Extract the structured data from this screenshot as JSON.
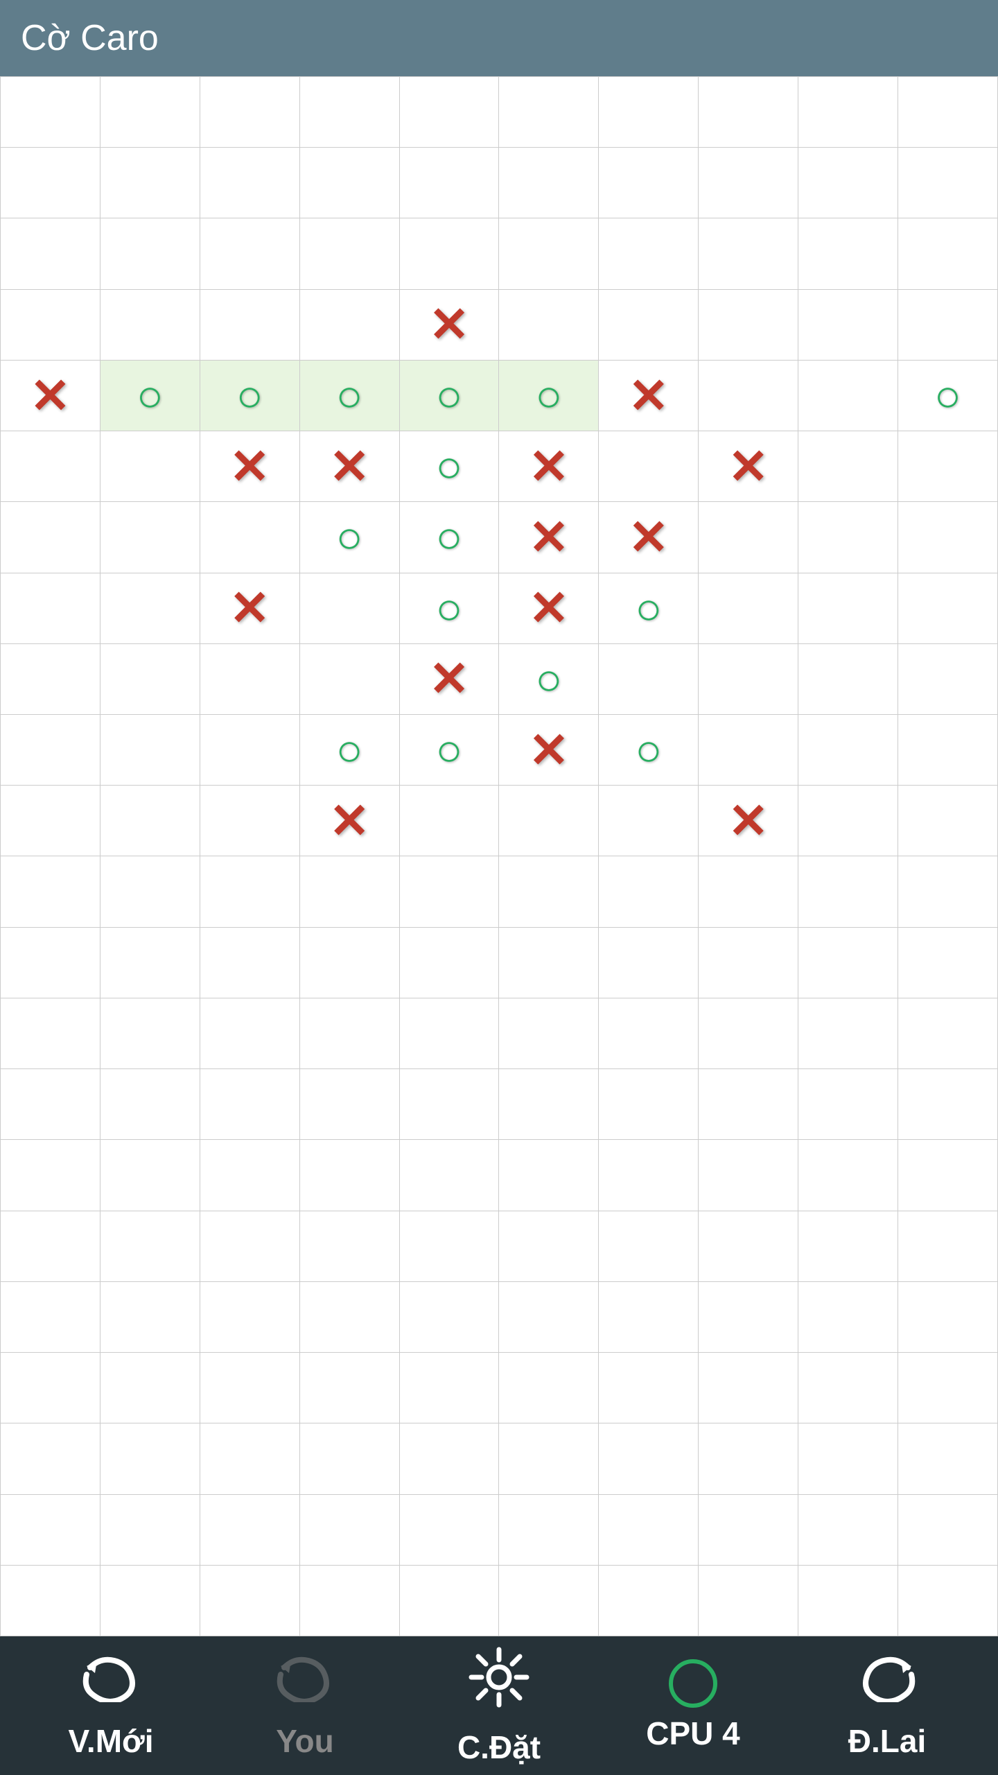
{
  "app": {
    "title": "Cờ Caro"
  },
  "board": {
    "rows": 22,
    "cols": 10,
    "cells": [
      {
        "row": 4,
        "col": 5,
        "piece": "X",
        "highlight": false
      },
      {
        "row": 5,
        "col": 1,
        "piece": "X",
        "highlight": false
      },
      {
        "row": 5,
        "col": 2,
        "piece": "O",
        "highlight": true
      },
      {
        "row": 5,
        "col": 3,
        "piece": "O",
        "highlight": true
      },
      {
        "row": 5,
        "col": 4,
        "piece": "O",
        "highlight": true
      },
      {
        "row": 5,
        "col": 5,
        "piece": "O",
        "highlight": true
      },
      {
        "row": 5,
        "col": 6,
        "piece": "O",
        "highlight": true
      },
      {
        "row": 5,
        "col": 7,
        "piece": "X",
        "highlight": false
      },
      {
        "row": 5,
        "col": 10,
        "piece": "O",
        "highlight": false
      },
      {
        "row": 6,
        "col": 3,
        "piece": "X",
        "highlight": false
      },
      {
        "row": 6,
        "col": 4,
        "piece": "X",
        "highlight": false
      },
      {
        "row": 6,
        "col": 5,
        "piece": "O",
        "highlight": false
      },
      {
        "row": 6,
        "col": 6,
        "piece": "X",
        "highlight": false
      },
      {
        "row": 6,
        "col": 8,
        "piece": "X",
        "highlight": false
      },
      {
        "row": 7,
        "col": 4,
        "piece": "O",
        "highlight": false
      },
      {
        "row": 7,
        "col": 5,
        "piece": "O",
        "highlight": false
      },
      {
        "row": 7,
        "col": 6,
        "piece": "X",
        "highlight": false
      },
      {
        "row": 7,
        "col": 7,
        "piece": "X",
        "highlight": false
      },
      {
        "row": 8,
        "col": 3,
        "piece": "X",
        "highlight": false
      },
      {
        "row": 8,
        "col": 5,
        "piece": "O",
        "highlight": false
      },
      {
        "row": 8,
        "col": 6,
        "piece": "X",
        "highlight": false
      },
      {
        "row": 8,
        "col": 7,
        "piece": "O",
        "highlight": false
      },
      {
        "row": 9,
        "col": 5,
        "piece": "X",
        "highlight": false
      },
      {
        "row": 9,
        "col": 6,
        "piece": "O",
        "highlight": false
      },
      {
        "row": 10,
        "col": 4,
        "piece": "O",
        "highlight": false
      },
      {
        "row": 10,
        "col": 5,
        "piece": "O",
        "highlight": false
      },
      {
        "row": 10,
        "col": 6,
        "piece": "X",
        "highlight": false
      },
      {
        "row": 10,
        "col": 7,
        "piece": "O",
        "highlight": false
      },
      {
        "row": 11,
        "col": 4,
        "piece": "X",
        "highlight": false
      },
      {
        "row": 11,
        "col": 8,
        "piece": "X",
        "highlight": false
      }
    ]
  },
  "bottom_bar": {
    "new_game_label": "V.Mới",
    "you_label": "You",
    "settings_label": "C.Đặt",
    "cpu_label": "CPU 4",
    "undo_label": "Đ.Lai"
  }
}
